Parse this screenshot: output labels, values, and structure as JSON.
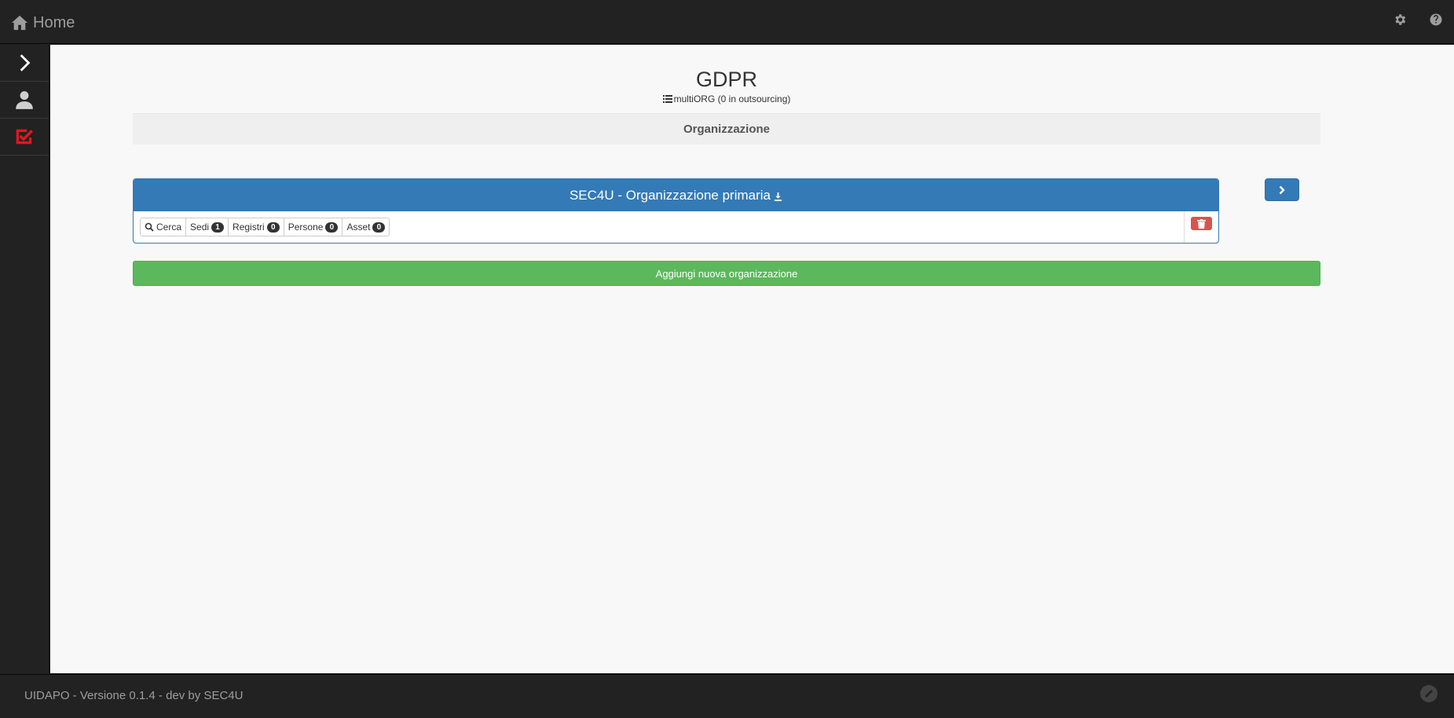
{
  "header": {
    "brand_label": "Home",
    "icons": [
      "home-icon",
      "gear-icon",
      "help-icon"
    ]
  },
  "sidebar": {
    "items": [
      {
        "icon": "chevron-right-icon"
      },
      {
        "icon": "user-icon"
      },
      {
        "icon": "checkbox-icon",
        "color": "#e8141f"
      }
    ]
  },
  "main": {
    "title": "GDPR",
    "subtitle": "multiORG (0 in outsourcing)",
    "section_label": "Organizzazione",
    "organization": {
      "name": "SEC4U - Organizzazione primaria",
      "buttons": [
        {
          "label": "Cerca"
        },
        {
          "label": "Sedi",
          "count": "1"
        },
        {
          "label": "Registri",
          "count": "0"
        },
        {
          "label": "Persone",
          "count": "0"
        },
        {
          "label": "Asset",
          "count": "0"
        }
      ]
    },
    "add_button_label": "Aggiungi nuova organizzazione"
  },
  "footer": {
    "text": "UIDAPO - Versione 0.1.4 - dev by SEC4U"
  },
  "colors": {
    "primary": "#337ab7",
    "success": "#5cb85c",
    "danger": "#d9534f",
    "navbar": "#222222"
  }
}
